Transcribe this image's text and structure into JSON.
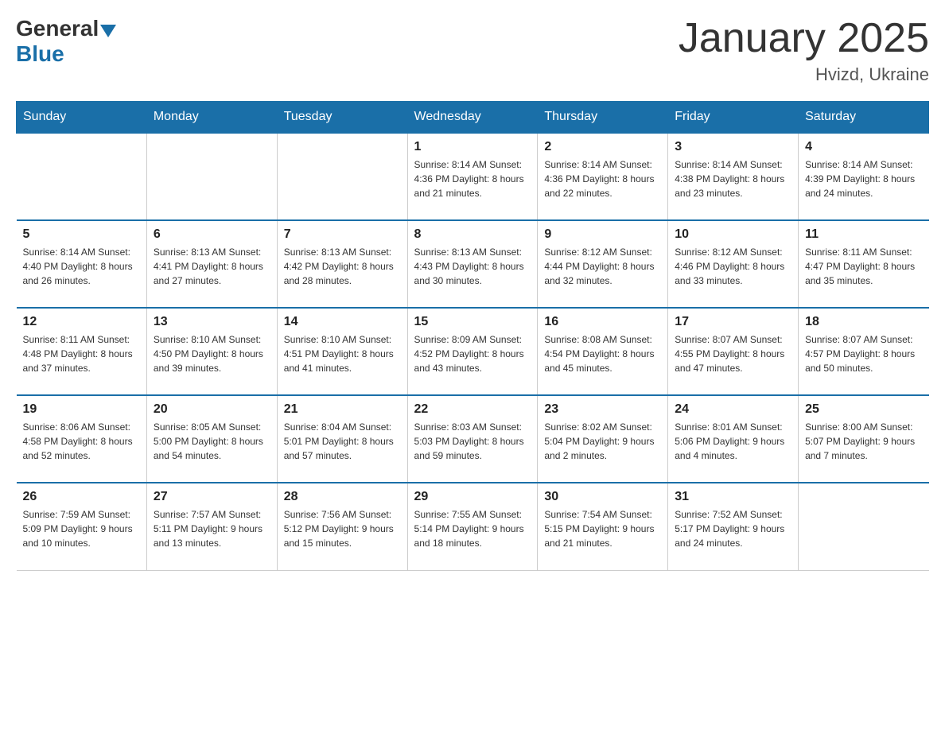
{
  "header": {
    "logo_general": "General",
    "logo_blue": "Blue",
    "month_title": "January 2025",
    "location": "Hvizd, Ukraine"
  },
  "weekdays": [
    "Sunday",
    "Monday",
    "Tuesday",
    "Wednesday",
    "Thursday",
    "Friday",
    "Saturday"
  ],
  "weeks": [
    [
      {
        "day": "",
        "info": ""
      },
      {
        "day": "",
        "info": ""
      },
      {
        "day": "",
        "info": ""
      },
      {
        "day": "1",
        "info": "Sunrise: 8:14 AM\nSunset: 4:36 PM\nDaylight: 8 hours\nand 21 minutes."
      },
      {
        "day": "2",
        "info": "Sunrise: 8:14 AM\nSunset: 4:36 PM\nDaylight: 8 hours\nand 22 minutes."
      },
      {
        "day": "3",
        "info": "Sunrise: 8:14 AM\nSunset: 4:38 PM\nDaylight: 8 hours\nand 23 minutes."
      },
      {
        "day": "4",
        "info": "Sunrise: 8:14 AM\nSunset: 4:39 PM\nDaylight: 8 hours\nand 24 minutes."
      }
    ],
    [
      {
        "day": "5",
        "info": "Sunrise: 8:14 AM\nSunset: 4:40 PM\nDaylight: 8 hours\nand 26 minutes."
      },
      {
        "day": "6",
        "info": "Sunrise: 8:13 AM\nSunset: 4:41 PM\nDaylight: 8 hours\nand 27 minutes."
      },
      {
        "day": "7",
        "info": "Sunrise: 8:13 AM\nSunset: 4:42 PM\nDaylight: 8 hours\nand 28 minutes."
      },
      {
        "day": "8",
        "info": "Sunrise: 8:13 AM\nSunset: 4:43 PM\nDaylight: 8 hours\nand 30 minutes."
      },
      {
        "day": "9",
        "info": "Sunrise: 8:12 AM\nSunset: 4:44 PM\nDaylight: 8 hours\nand 32 minutes."
      },
      {
        "day": "10",
        "info": "Sunrise: 8:12 AM\nSunset: 4:46 PM\nDaylight: 8 hours\nand 33 minutes."
      },
      {
        "day": "11",
        "info": "Sunrise: 8:11 AM\nSunset: 4:47 PM\nDaylight: 8 hours\nand 35 minutes."
      }
    ],
    [
      {
        "day": "12",
        "info": "Sunrise: 8:11 AM\nSunset: 4:48 PM\nDaylight: 8 hours\nand 37 minutes."
      },
      {
        "day": "13",
        "info": "Sunrise: 8:10 AM\nSunset: 4:50 PM\nDaylight: 8 hours\nand 39 minutes."
      },
      {
        "day": "14",
        "info": "Sunrise: 8:10 AM\nSunset: 4:51 PM\nDaylight: 8 hours\nand 41 minutes."
      },
      {
        "day": "15",
        "info": "Sunrise: 8:09 AM\nSunset: 4:52 PM\nDaylight: 8 hours\nand 43 minutes."
      },
      {
        "day": "16",
        "info": "Sunrise: 8:08 AM\nSunset: 4:54 PM\nDaylight: 8 hours\nand 45 minutes."
      },
      {
        "day": "17",
        "info": "Sunrise: 8:07 AM\nSunset: 4:55 PM\nDaylight: 8 hours\nand 47 minutes."
      },
      {
        "day": "18",
        "info": "Sunrise: 8:07 AM\nSunset: 4:57 PM\nDaylight: 8 hours\nand 50 minutes."
      }
    ],
    [
      {
        "day": "19",
        "info": "Sunrise: 8:06 AM\nSunset: 4:58 PM\nDaylight: 8 hours\nand 52 minutes."
      },
      {
        "day": "20",
        "info": "Sunrise: 8:05 AM\nSunset: 5:00 PM\nDaylight: 8 hours\nand 54 minutes."
      },
      {
        "day": "21",
        "info": "Sunrise: 8:04 AM\nSunset: 5:01 PM\nDaylight: 8 hours\nand 57 minutes."
      },
      {
        "day": "22",
        "info": "Sunrise: 8:03 AM\nSunset: 5:03 PM\nDaylight: 8 hours\nand 59 minutes."
      },
      {
        "day": "23",
        "info": "Sunrise: 8:02 AM\nSunset: 5:04 PM\nDaylight: 9 hours\nand 2 minutes."
      },
      {
        "day": "24",
        "info": "Sunrise: 8:01 AM\nSunset: 5:06 PM\nDaylight: 9 hours\nand 4 minutes."
      },
      {
        "day": "25",
        "info": "Sunrise: 8:00 AM\nSunset: 5:07 PM\nDaylight: 9 hours\nand 7 minutes."
      }
    ],
    [
      {
        "day": "26",
        "info": "Sunrise: 7:59 AM\nSunset: 5:09 PM\nDaylight: 9 hours\nand 10 minutes."
      },
      {
        "day": "27",
        "info": "Sunrise: 7:57 AM\nSunset: 5:11 PM\nDaylight: 9 hours\nand 13 minutes."
      },
      {
        "day": "28",
        "info": "Sunrise: 7:56 AM\nSunset: 5:12 PM\nDaylight: 9 hours\nand 15 minutes."
      },
      {
        "day": "29",
        "info": "Sunrise: 7:55 AM\nSunset: 5:14 PM\nDaylight: 9 hours\nand 18 minutes."
      },
      {
        "day": "30",
        "info": "Sunrise: 7:54 AM\nSunset: 5:15 PM\nDaylight: 9 hours\nand 21 minutes."
      },
      {
        "day": "31",
        "info": "Sunrise: 7:52 AM\nSunset: 5:17 PM\nDaylight: 9 hours\nand 24 minutes."
      },
      {
        "day": "",
        "info": ""
      }
    ]
  ]
}
